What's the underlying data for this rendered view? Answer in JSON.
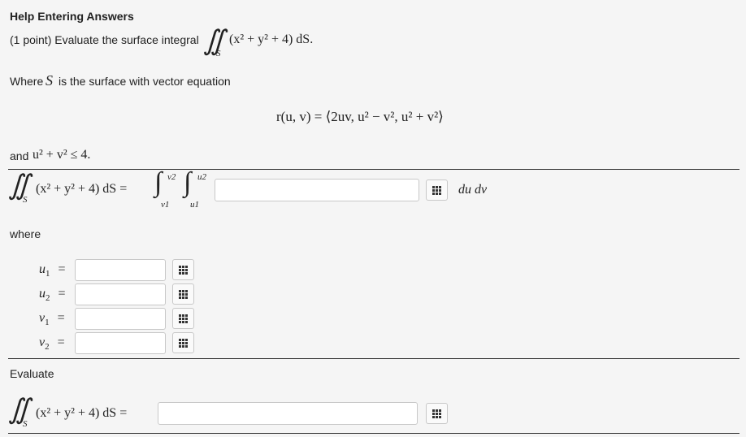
{
  "heading": "Help Entering Answers",
  "problem": {
    "points": "(1 point) Evaluate the surface integral",
    "integrand": "(x² + y² + 4) dS.",
    "where_text": "Where",
    "surface_symbol": "S",
    "surface_desc": "is the surface with vector equation",
    "vector_eq": "r(u, v) = ⟨2uv, u² − v², u² + v²⟩",
    "constraint_prefix": "and",
    "constraint": "u² + v² ≤ 4."
  },
  "rewrite": {
    "lhs": "(x² + y² + 4)  dS =",
    "upper_v": "v2",
    "lower_v": "v1",
    "upper_u": "u2",
    "lower_u": "u1",
    "differential": "du dv"
  },
  "where_label": "where",
  "limits": [
    {
      "label": "u",
      "sub": "1",
      "eq": "="
    },
    {
      "label": "u",
      "sub": "2",
      "eq": "="
    },
    {
      "label": "v",
      "sub": "1",
      "eq": "="
    },
    {
      "label": "v",
      "sub": "2",
      "eq": "="
    }
  ],
  "evaluate_label": "Evaluate",
  "final": {
    "lhs": "(x² + y² + 4)  dS ="
  },
  "icon_names": [
    "grid-icon"
  ]
}
